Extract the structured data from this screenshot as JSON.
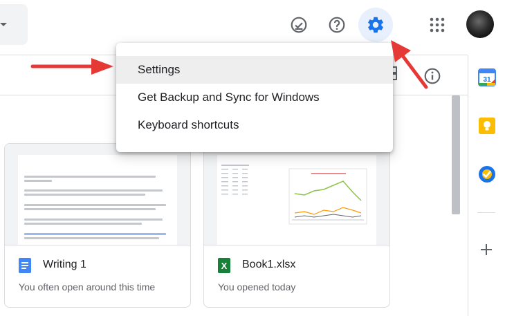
{
  "header": {
    "icons": [
      "ready-offline-icon",
      "help-icon",
      "gear-icon",
      "apps-icon"
    ]
  },
  "menu": {
    "items": [
      {
        "label": "Settings"
      },
      {
        "label": "Get Backup and Sync for Windows"
      },
      {
        "label": "Keyboard shortcuts"
      }
    ]
  },
  "side_apps": {
    "calendar_day": "31",
    "icons": [
      "calendar-icon",
      "keep-icon",
      "tasks-icon",
      "add-icon"
    ]
  },
  "cards": [
    {
      "name": "Writing 1",
      "reason": "You often open around this time",
      "icon": "docs-icon"
    },
    {
      "name": "Book1.xlsx",
      "reason": "You opened today",
      "icon": "sheets-icon"
    }
  ],
  "colors": {
    "accent": "#1a73e8",
    "annotation_arrow": "#e53935",
    "docs_blue": "#4285f4",
    "sheets_green": "#188038"
  }
}
